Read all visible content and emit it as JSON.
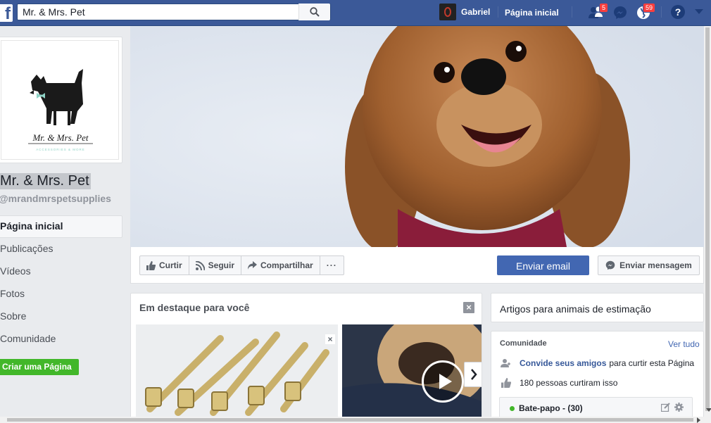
{
  "topbar": {
    "search_value": "Mr. & Mrs. Pet",
    "user_name": "Gabriel",
    "home_label": "Página inicial",
    "friend_requests_count": "5",
    "notifications_count": "59",
    "help_label": "?"
  },
  "sidebar": {
    "page_name": "Mr. & Mrs. Pet",
    "page_handle": "@mrandmrspetsupplies",
    "logo_text_main": "Mr. & Mrs. Pet",
    "logo_text_sub": "ACCESSORIES & MORE",
    "items": [
      {
        "label": "Página inicial",
        "active": true
      },
      {
        "label": "Publicações",
        "active": false
      },
      {
        "label": "Vídeos",
        "active": false
      },
      {
        "label": "Fotos",
        "active": false
      },
      {
        "label": "Sobre",
        "active": false
      },
      {
        "label": "Comunidade",
        "active": false
      }
    ],
    "create_page_label": "Criar uma Página"
  },
  "actions": {
    "like_label": "Curtir",
    "follow_label": "Seguir",
    "share_label": "Compartilhar",
    "more_label": "···",
    "email_label": "Enviar email",
    "message_label": "Enviar mensagem"
  },
  "featured": {
    "title": "Em destaque para você"
  },
  "right": {
    "category": "Artigos para animais de estimação",
    "community_title": "Comunidade",
    "see_all": "Ver tudo",
    "invite_link": "Convide seus amigos",
    "invite_rest": "para curtir esta Página",
    "likes_text": "180 pessoas curtiram isso",
    "chat_label": "Bate-papo - (30)"
  },
  "colors": {
    "brand": "#3b5998",
    "primary_button": "#4267b2",
    "create_button": "#42b72a",
    "badge": "#fa3e3e"
  }
}
